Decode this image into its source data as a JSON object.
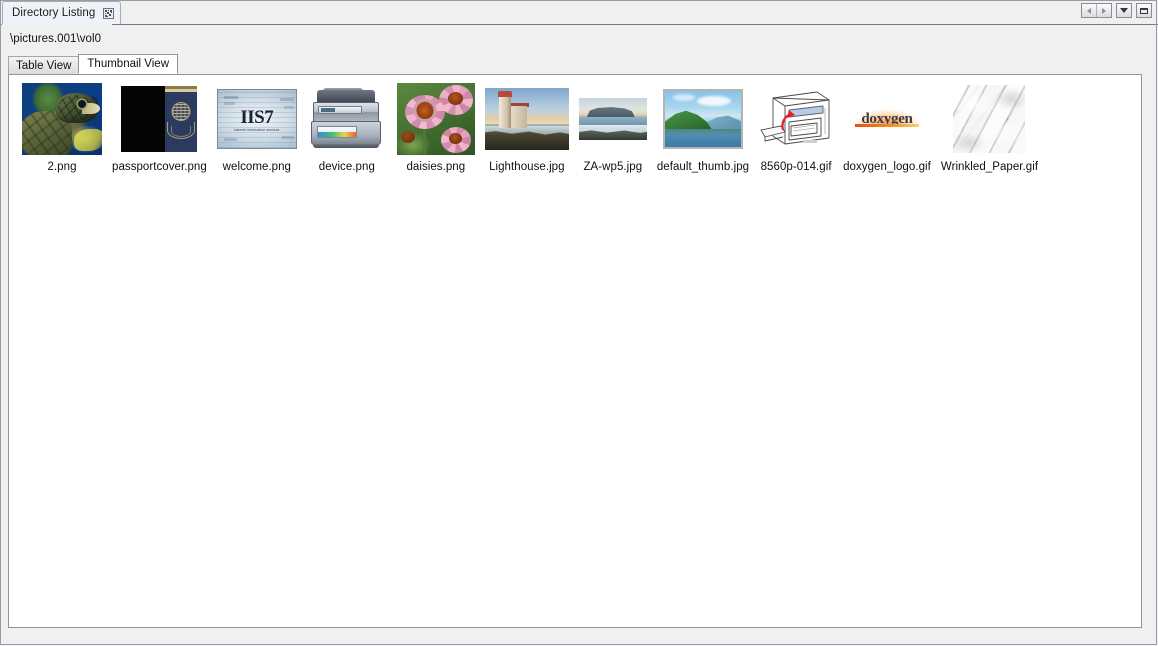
{
  "window": {
    "tab": {
      "title": "Directory Listing",
      "close_icon": "close-icon"
    },
    "controls": {
      "prev_icon": "arrow-left-icon",
      "next_icon": "arrow-right-icon",
      "menu_icon": "chevron-down-icon",
      "maximize_icon": "maximize-icon"
    }
  },
  "path": {
    "value": "\\pictures.001\\vol0"
  },
  "view_tabs": [
    {
      "label": "Table View",
      "selected": false
    },
    {
      "label": "Thumbnail View",
      "selected": true
    }
  ],
  "thumbnails": [
    {
      "name": "2.png",
      "art": "turtle"
    },
    {
      "name": "passportcover.png",
      "art": "passport"
    },
    {
      "name": "welcome.png",
      "art": "iis7"
    },
    {
      "name": "device.png",
      "art": "printer-device"
    },
    {
      "name": "daisies.png",
      "art": "coneflowers"
    },
    {
      "name": "Lighthouse.jpg",
      "art": "lighthouse"
    },
    {
      "name": "ZA-wp5.jpg",
      "art": "table-mountain-coast"
    },
    {
      "name": "default_thumb.jpg",
      "art": "green-island-lake"
    },
    {
      "name": "8560p-014.gif",
      "art": "printer-line-drawing"
    },
    {
      "name": "doxygen_logo.gif",
      "art": "doxygen-logo"
    },
    {
      "name": "Wrinkled_Paper.gif",
      "art": "wrinkled-paper"
    }
  ],
  "colors": {
    "window_bg": "#f0f0f0",
    "window_border": "#9a9ba5",
    "panel_bg": "#ffffff",
    "panel_border": "#8f949c",
    "tab_active_bg": "#ffffff",
    "tab_inactive_bg": "#dcdcdc",
    "text": "#111111",
    "doxygen_accent": "#e84b10"
  }
}
